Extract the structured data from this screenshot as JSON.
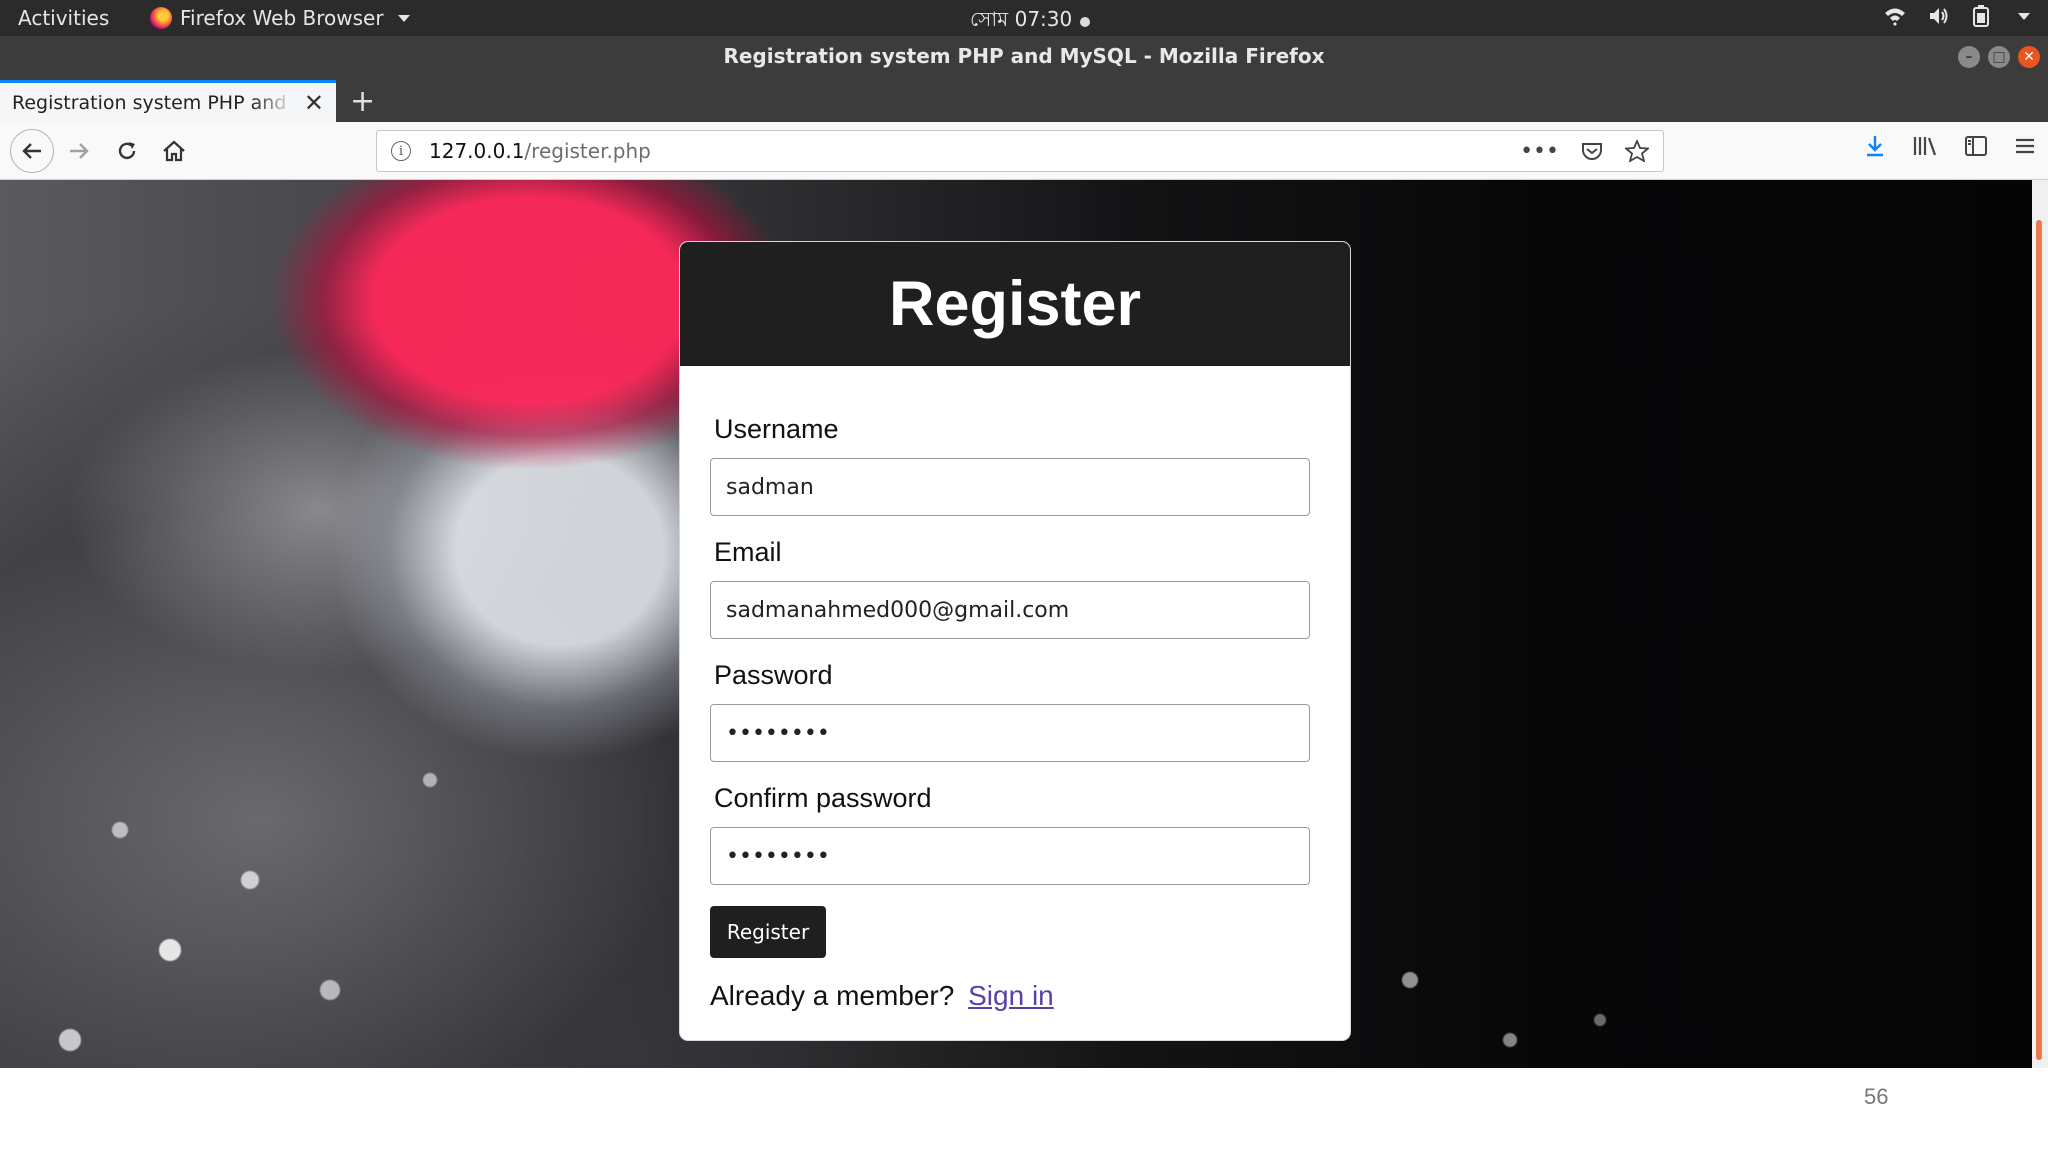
{
  "system_bar": {
    "activities": "Activities",
    "app_name": "Firefox Web Browser",
    "clock": "সোম 07:30"
  },
  "window": {
    "title": "Registration system PHP and MySQL - Mozilla Firefox"
  },
  "tabs": [
    {
      "title": "Registration system PHP and MySQL"
    }
  ],
  "address_bar": {
    "host": "127.0.0.1",
    "path": "/register.php"
  },
  "form": {
    "heading": "Register",
    "fields": [
      {
        "label": "Username",
        "value": "sadman",
        "type": "text"
      },
      {
        "label": "Email",
        "value": "sadmanahmed000@gmail.com",
        "type": "text"
      },
      {
        "label": "Password",
        "value": "password",
        "type": "password"
      },
      {
        "label": "Confirm password",
        "value": "password",
        "type": "password"
      }
    ],
    "submit_label": "Register",
    "member_text": "Already a member?",
    "signin_label": "Sign in"
  },
  "slide": {
    "page_number": "56"
  },
  "colors": {
    "card_header": "#1f1f1f",
    "link": "#5a3fa8",
    "tab_accent": "#0a84ff"
  }
}
